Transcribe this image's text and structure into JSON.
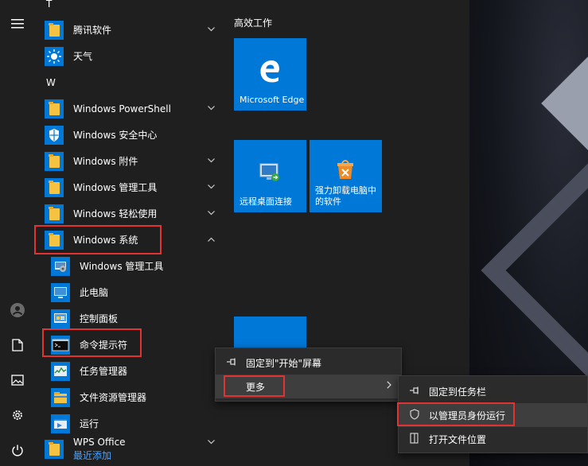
{
  "sections": {
    "top_letter": "T",
    "w_letter": "W"
  },
  "rail": {
    "menu_icon": "hamburger-icon",
    "user_icon": "avatar-icon",
    "docs_icon": "document-icon",
    "pictures_icon": "pictures-icon",
    "settings_icon": "gear-icon",
    "power_icon": "power-icon"
  },
  "apps": {
    "tencent": "腾讯软件",
    "weather": "天气",
    "powershell": "Windows PowerShell",
    "security": "Windows 安全中心",
    "accessories": "Windows 附件",
    "admin_tools": "Windows 管理工具",
    "ease": "Windows 轻松使用",
    "system": "Windows 系统",
    "wps": "WPS Office",
    "wps_sub": "最近添加"
  },
  "system_items": {
    "admin_tools": "Windows 管理工具",
    "this_pc": "此电脑",
    "control_panel": "控制面板",
    "cmd": "命令提示符",
    "task_manager": "任务管理器",
    "explorer": "文件资源管理器",
    "run": "运行"
  },
  "tiles": {
    "group_title": "高效工作",
    "edge": "Microsoft Edge",
    "rdp": "远程桌面连接",
    "uninstall_line1": "强力卸载电脑中",
    "uninstall_line2": "的软件"
  },
  "context_menu": {
    "pin_start": "固定到\"开始\"屏幕",
    "more": "更多"
  },
  "submenu": {
    "pin_taskbar": "固定到任务栏",
    "run_as_admin": "以管理员身份运行",
    "open_location": "打开文件位置"
  },
  "colors": {
    "accent": "#0078d7",
    "highlight_box": "#e23232",
    "folder": "#f5c242"
  }
}
